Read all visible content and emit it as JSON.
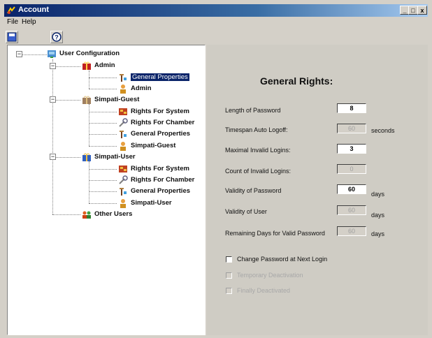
{
  "window": {
    "title": "Account",
    "min": "_",
    "max": "□",
    "close": "x"
  },
  "menu": [
    "File",
    "Help"
  ],
  "toolbar": {
    "icons": [
      "save-icon",
      "help-icon"
    ]
  },
  "tree": {
    "root": "User Configuration",
    "groups": [
      {
        "name": "Admin",
        "items": [
          "General Properties",
          "Admin"
        ],
        "selected": "General Properties"
      },
      {
        "name": "Simpati-Guest",
        "items": [
          "Rights For System",
          "Rights For Chamber",
          "General Properties",
          "Simpati-Guest"
        ]
      },
      {
        "name": "Simpati-User",
        "items": [
          "Rights For System",
          "Rights For Chamber",
          "General Properties",
          "Simpati-User"
        ]
      }
    ],
    "other": "Other Users"
  },
  "panel": {
    "heading": "General Rights:",
    "fields": [
      {
        "label": "Length of Password",
        "value": "8",
        "unit": "",
        "enabled": true
      },
      {
        "label": "Timespan Auto Logoff:",
        "value": "60",
        "unit": "seconds",
        "enabled": false
      },
      {
        "label": "Maximal Invalid Logins:",
        "value": "3",
        "unit": "",
        "enabled": true
      },
      {
        "label": "Count of Invalid Logins:",
        "value": "0",
        "unit": "",
        "enabled": false
      },
      {
        "label": "Validity of Password",
        "value": "60",
        "unit": "days",
        "enabled": true
      },
      {
        "label": "Validity of User",
        "value": "60",
        "unit": "days",
        "enabled": false
      },
      {
        "label": "Remaining Days for Valid Password",
        "value": "60",
        "unit": "days",
        "enabled": false
      }
    ],
    "checkboxes": [
      {
        "label": "Change Password at Next Login",
        "enabled": true
      },
      {
        "label": "Temporary Deactivation",
        "enabled": false
      },
      {
        "label": "Finally Deactivated",
        "enabled": false
      }
    ]
  },
  "colors": {
    "titlebar": "#0a246a",
    "selection": "#0a246a",
    "panel": "#cfccc4"
  }
}
